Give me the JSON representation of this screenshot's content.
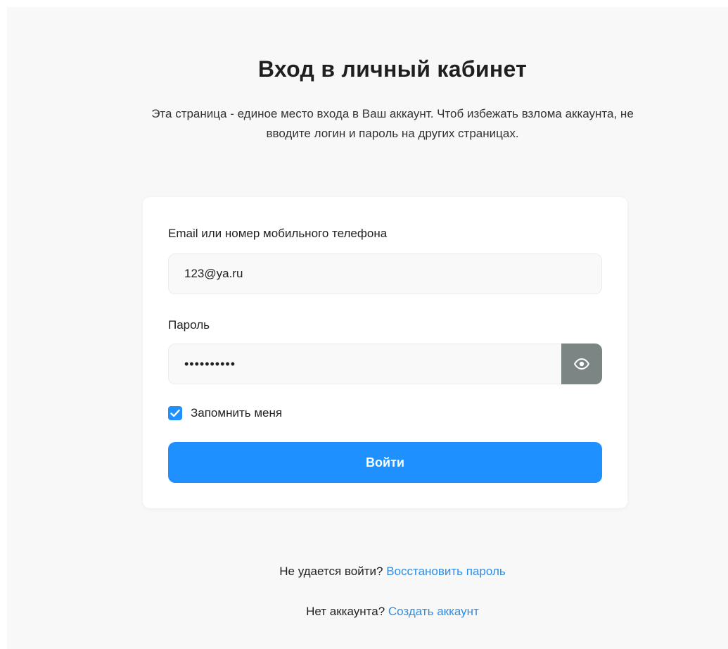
{
  "header": {
    "title": "Вход в личный кабинет",
    "subtitle": "Эта страница - единое место входа в Ваш аккаунт. Чтоб избежать взлома аккаунта, не вводите логин и пароль на других страницах."
  },
  "form": {
    "email_label": "Email или номер мобильного телефона",
    "email_value": "123@ya.ru",
    "password_label": "Пароль",
    "password_value": "••••••••••",
    "show_password_icon": "eye-icon",
    "remember_label": "Запомнить меня",
    "remember_checked": true,
    "submit_label": "Войти"
  },
  "footer": {
    "recover_prompt": "Не удается войти?",
    "recover_link": "Восстановить пароль",
    "register_prompt": "Нет аккаунта?",
    "register_link": "Создать аккаунт"
  },
  "colors": {
    "accent": "#1e90ff",
    "link": "#2f8de4",
    "eye_button": "#7a8584",
    "background": "#f8f8f8"
  }
}
